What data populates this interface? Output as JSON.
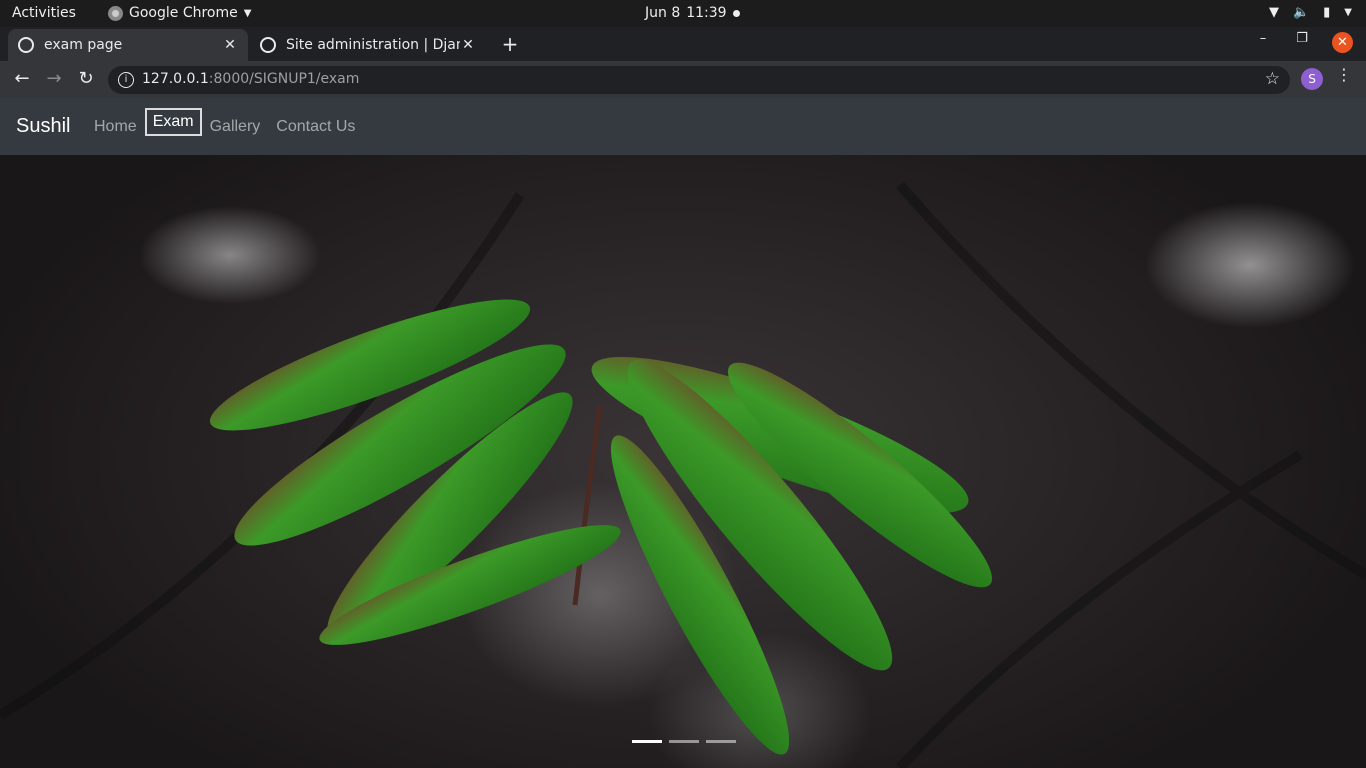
{
  "os": {
    "activities": "Activities",
    "app_name": "Google Chrome",
    "date": "Jun 8",
    "time": "11:39"
  },
  "browser": {
    "tabs": [
      {
        "title": "exam page",
        "active": true
      },
      {
        "title": "Site administration | Djan",
        "active": false
      }
    ],
    "url_host": "127.0.0.1",
    "url_rest": ":8000/SIGNUP1/exam",
    "profile_initial": "S"
  },
  "navbar": {
    "brand": "Sushil",
    "links": [
      {
        "label": "Home"
      },
      {
        "label": "Exam",
        "active": true
      },
      {
        "label": "Gallery"
      },
      {
        "label": "Contact Us"
      }
    ]
  },
  "carousel": {
    "slide_count": 3,
    "active_index": 0
  },
  "colors": {
    "navbar_bg": "#343a40",
    "leaf_green": "#3fae2a",
    "close_button": "#e95420"
  }
}
